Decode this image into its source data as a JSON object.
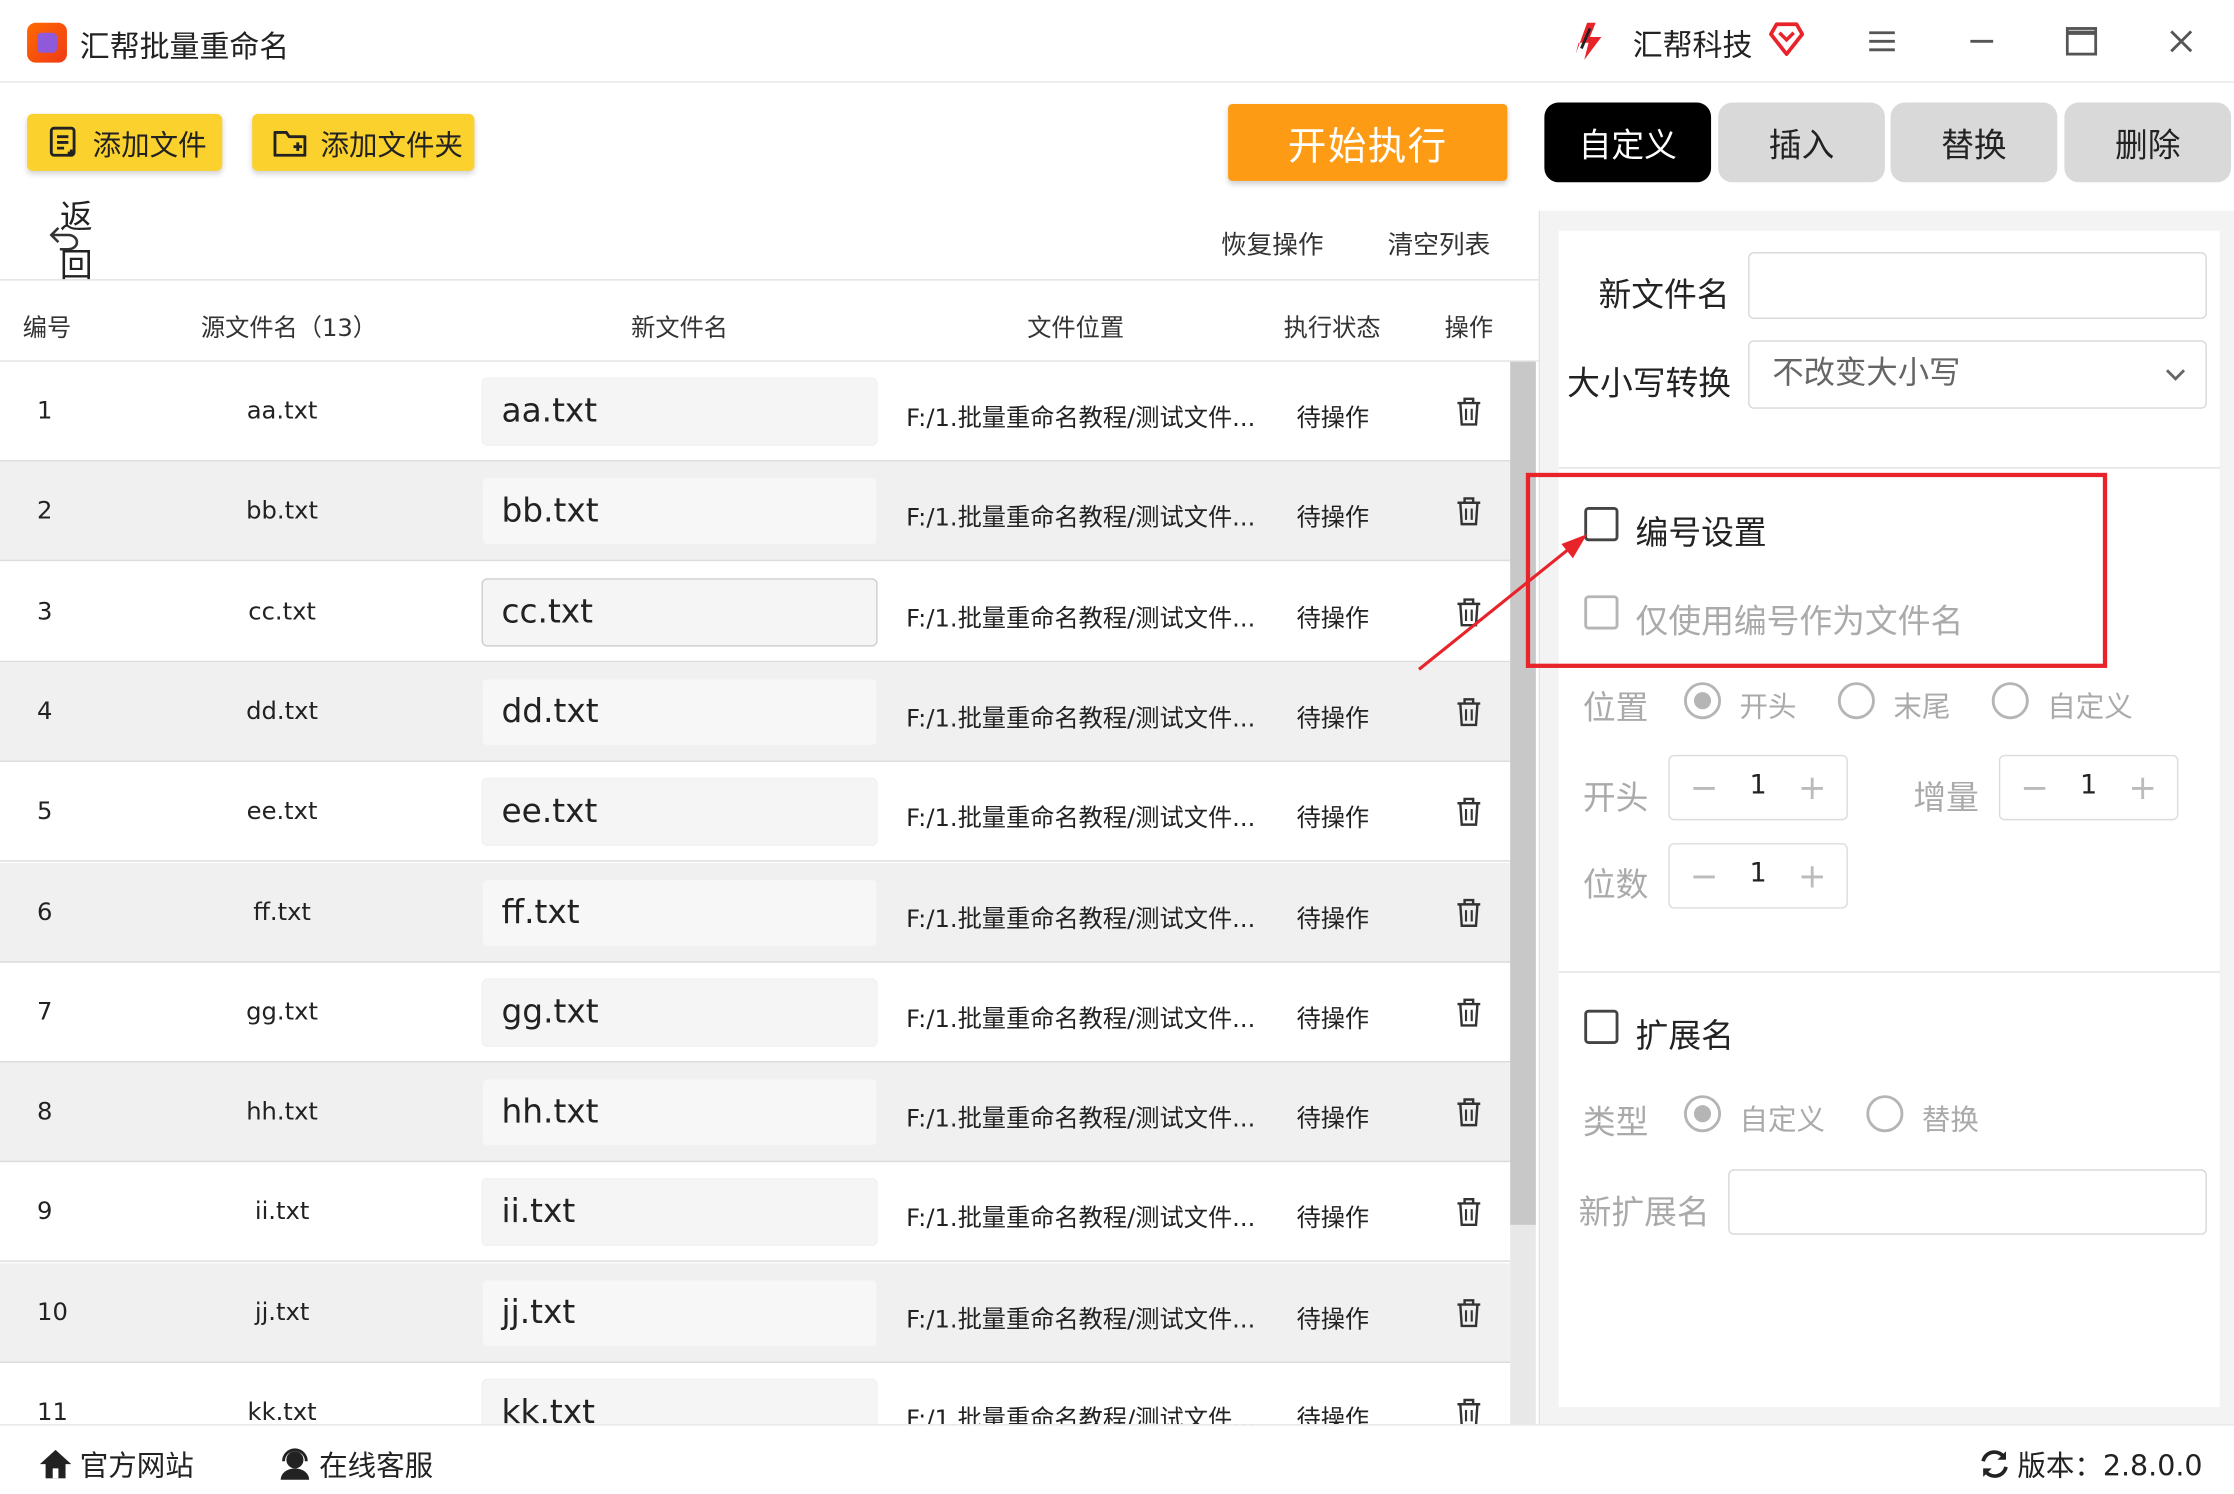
{
  "titlebar": {
    "app_title": "汇帮批量重命名",
    "brand_name": "汇帮科技"
  },
  "toolbar": {
    "add_file_label": "添加文件",
    "add_folder_label": "添加文件夹",
    "start_label": "开始执行"
  },
  "tabs": [
    {
      "label": "自定义",
      "active": true
    },
    {
      "label": "插入",
      "active": false
    },
    {
      "label": "替换",
      "active": false
    },
    {
      "label": "删除",
      "active": false
    }
  ],
  "subtoolbar": {
    "back_label": "返回",
    "restore_label": "恢复操作",
    "clear_label": "清空列表"
  },
  "table": {
    "headers": {
      "num": "编号",
      "src": "源文件名（13）",
      "new": "新文件名",
      "path": "文件位置",
      "status": "执行状态",
      "op": "操作"
    },
    "rows": [
      {
        "num": "1",
        "src": "aa.txt",
        "new": "aa.txt",
        "path": "F:/1.批量重命名教程/测试文件...",
        "status": "待操作"
      },
      {
        "num": "2",
        "src": "bb.txt",
        "new": "bb.txt",
        "path": "F:/1.批量重命名教程/测试文件...",
        "status": "待操作"
      },
      {
        "num": "3",
        "src": "cc.txt",
        "new": "cc.txt",
        "path": "F:/1.批量重命名教程/测试文件...",
        "status": "待操作"
      },
      {
        "num": "4",
        "src": "dd.txt",
        "new": "dd.txt",
        "path": "F:/1.批量重命名教程/测试文件...",
        "status": "待操作"
      },
      {
        "num": "5",
        "src": "ee.txt",
        "new": "ee.txt",
        "path": "F:/1.批量重命名教程/测试文件...",
        "status": "待操作"
      },
      {
        "num": "6",
        "src": "ff.txt",
        "new": "ff.txt",
        "path": "F:/1.批量重命名教程/测试文件...",
        "status": "待操作"
      },
      {
        "num": "7",
        "src": "gg.txt",
        "new": "gg.txt",
        "path": "F:/1.批量重命名教程/测试文件...",
        "status": "待操作"
      },
      {
        "num": "8",
        "src": "hh.txt",
        "new": "hh.txt",
        "path": "F:/1.批量重命名教程/测试文件...",
        "status": "待操作"
      },
      {
        "num": "9",
        "src": "ii.txt",
        "new": "ii.txt",
        "path": "F:/1.批量重命名教程/测试文件...",
        "status": "待操作"
      },
      {
        "num": "10",
        "src": "jj.txt",
        "new": "jj.txt",
        "path": "F:/1.批量重命名教程/测试文件...",
        "status": "待操作"
      },
      {
        "num": "11",
        "src": "kk.txt",
        "new": "kk.txt",
        "path": "F:/1.批量重命名教程/测试文件...",
        "status": "待操作"
      }
    ]
  },
  "panel": {
    "new_name_label": "新文件名",
    "new_name_value": "",
    "case_label": "大小写转换",
    "case_value": "不改变大小写",
    "numbering_label": "编号设置",
    "numbering_checked": false,
    "only_number_label": "仅使用编号作为文件名",
    "position_label": "位置",
    "position_options": [
      "开头",
      "末尾",
      "自定义"
    ],
    "position_selected": "开头",
    "start_label": "开头",
    "start_value": "1",
    "increment_label": "增量",
    "increment_value": "1",
    "digits_label": "位数",
    "digits_value": "1",
    "minus": "−",
    "plus": "+",
    "ext_label": "扩展名",
    "ext_checked": false,
    "type_label": "类型",
    "type_options": [
      "自定义",
      "替换"
    ],
    "type_selected": "自定义",
    "new_ext_label": "新扩展名",
    "new_ext_value": ""
  },
  "footer": {
    "website_label": "官方网站",
    "support_label": "在线客服",
    "version_label": "版本：2.8.0.0"
  },
  "colors": {
    "yellow_button": "#fbd12e",
    "start_button": "#fe9b14",
    "tab_active": "#000000",
    "tab_inactive": "#d9d9d9",
    "annotation_red": "#e8242a"
  }
}
